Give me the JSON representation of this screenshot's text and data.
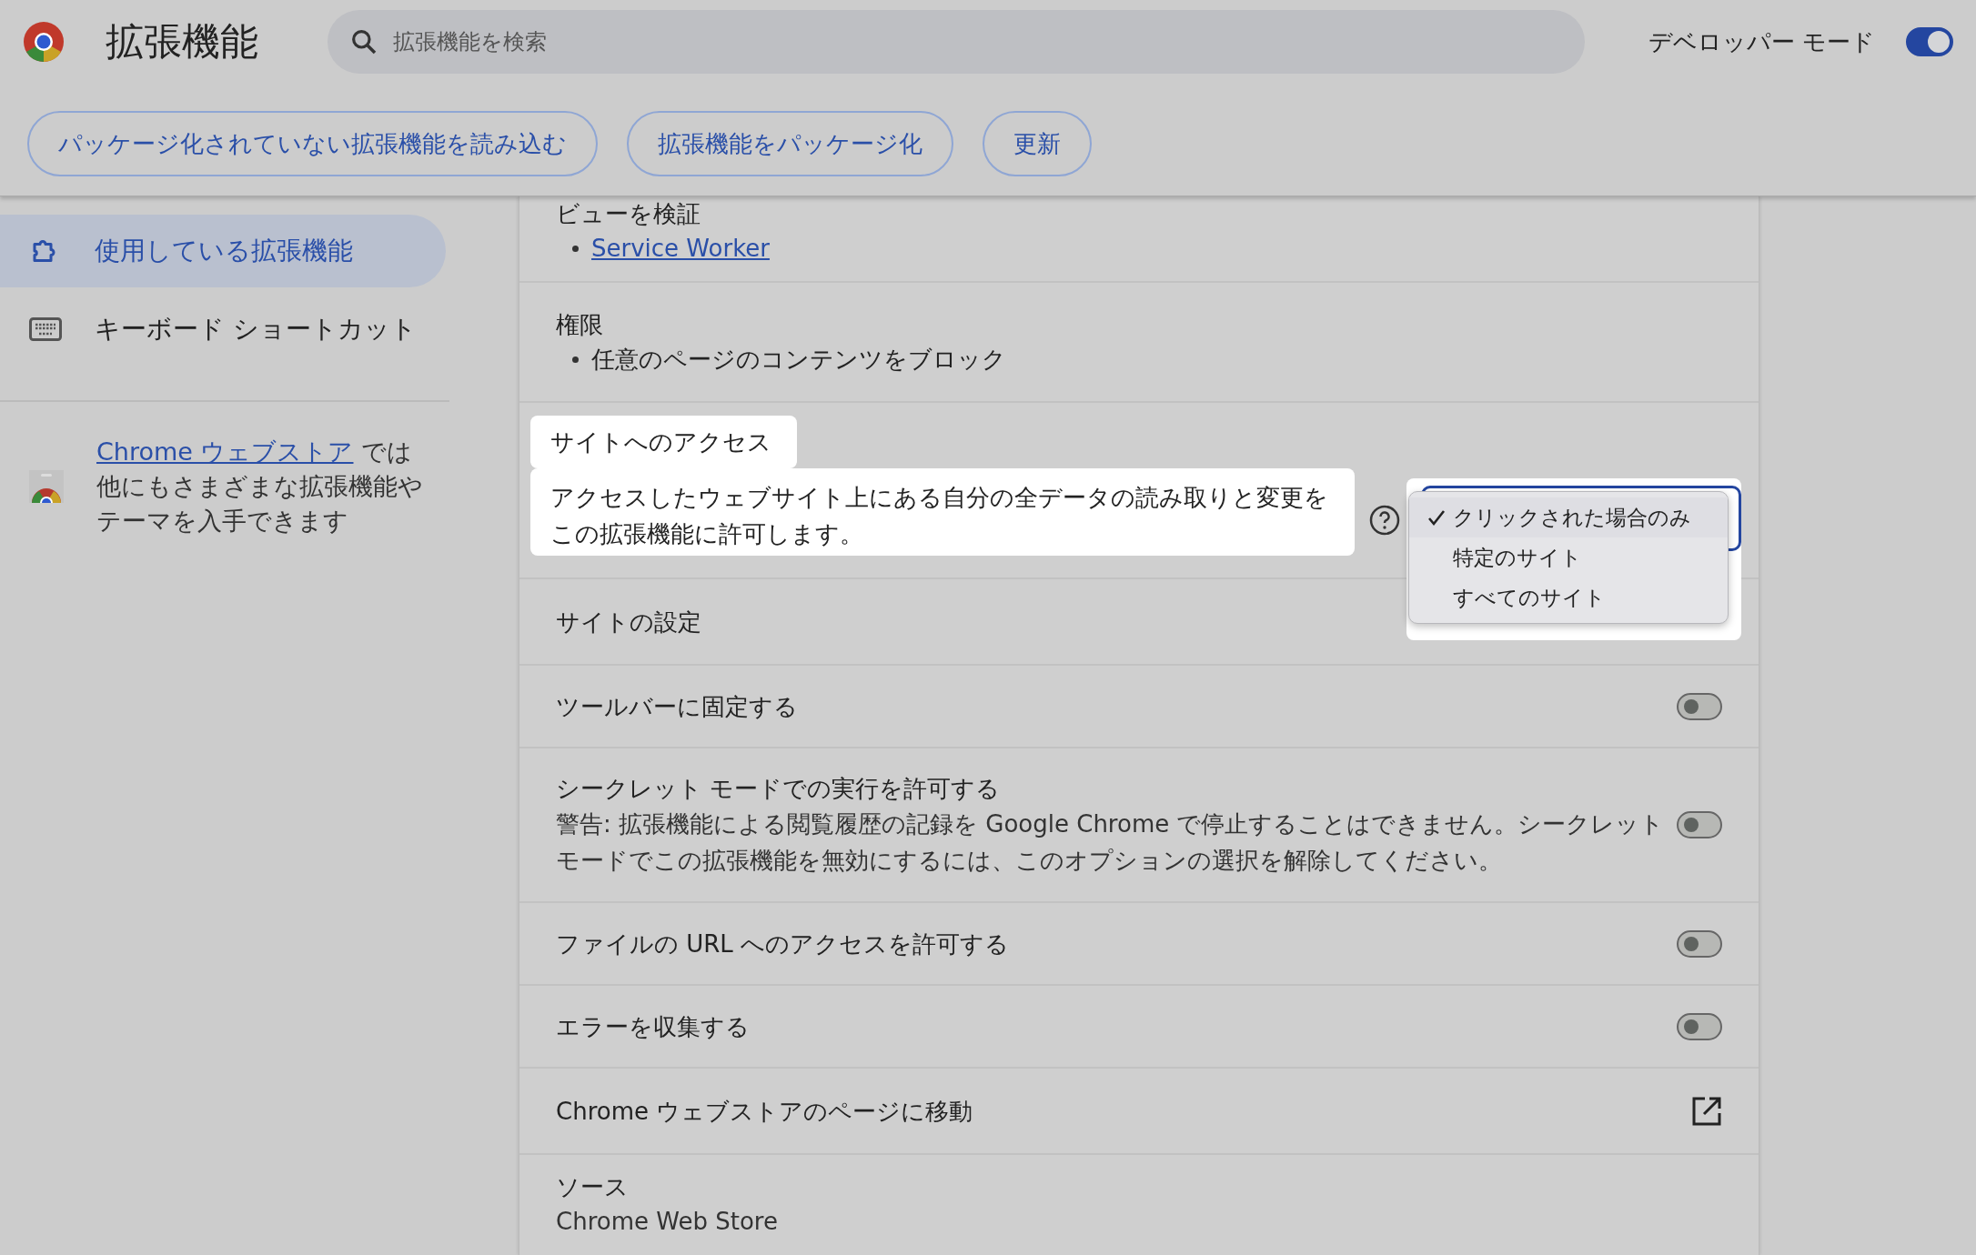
{
  "header": {
    "title": "拡張機能",
    "search": {
      "placeholder": "拡張機能を検索"
    },
    "developer_mode": {
      "label": "デベロッパー モード",
      "on": true
    }
  },
  "toolbar_buttons": [
    "パッケージ化されていない拡張機能を読み込む",
    "拡張機能をパッケージ化",
    "更新"
  ],
  "sidebar": {
    "items": [
      {
        "label": "使用している拡張機能",
        "kind": "puzzle",
        "selected": true
      },
      {
        "label": "キーボード ショートカット",
        "kind": "keyboard",
        "selected": false
      }
    ],
    "promo": {
      "link": "Chrome ウェブストア",
      "text": "では他にもさまざまな拡張機能やテーマを入手できます"
    }
  },
  "details": {
    "inspect_views": {
      "label": "ビューを検証",
      "links": [
        "Service Worker"
      ]
    },
    "permissions": {
      "title": "権限",
      "items": [
        "任意のページのコンテンツをブロック"
      ]
    },
    "site_access": {
      "title": "サイトへのアクセス",
      "description": "アクセスしたウェブサイト上にある自分の全データの読み取りと変更をこの拡張機能に許可します。",
      "options": [
        {
          "label": "クリックされた場合のみ",
          "selected": true
        },
        {
          "label": "特定のサイト",
          "selected": false
        },
        {
          "label": "すべてのサイト",
          "selected": false
        }
      ]
    },
    "rows": [
      {
        "kind": "plain",
        "label": "サイトの設定"
      },
      {
        "kind": "toggle",
        "label": "ツールバーに固定する",
        "on": false
      },
      {
        "kind": "toggle",
        "label": "シークレット モードでの実行を許可する",
        "warning": "警告: 拡張機能による閲覧履歴の記録を Google Chrome で停止することはできません。シークレットモードでこの拡張機能を無効にするには、このオプションの選択を解除してください。",
        "on": false
      },
      {
        "kind": "toggle",
        "label": "ファイルの URL へのアクセスを許可する",
        "on": false
      },
      {
        "kind": "toggle",
        "label": "エラーを収集する",
        "on": false
      },
      {
        "kind": "external",
        "label": "Chrome ウェブストアのページに移動"
      },
      {
        "kind": "info",
        "label": "ソース",
        "value": "Chrome Web Store"
      }
    ]
  }
}
